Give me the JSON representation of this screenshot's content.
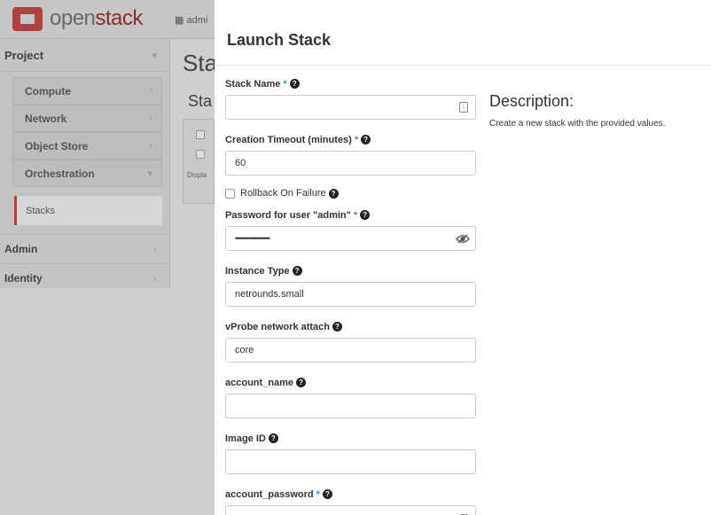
{
  "header": {
    "logo_left": "open",
    "logo_right": "stack",
    "project_switch": "admi"
  },
  "sidebar": {
    "project": "Project",
    "compute": "Compute",
    "network": "Network",
    "object_store": "Object Store",
    "orchestration": "Orchestration",
    "stacks": "Stacks",
    "admin": "Admin",
    "identity": "Identity"
  },
  "background": {
    "page_title": "Sta",
    "sub_title": "Sta",
    "table_hint": "Displa"
  },
  "modal": {
    "title": "Launch Stack",
    "description_title": "Description:",
    "description_text": "Create a new stack with the provided values.",
    "fields": {
      "stack_name": {
        "label": "Stack Name",
        "value": ""
      },
      "timeout": {
        "label": "Creation Timeout (minutes)",
        "value": "60"
      },
      "rollback": {
        "label": "Rollback On Failure"
      },
      "password": {
        "label": "Password for user \"admin\"",
        "value": "••••••••••••••••••"
      },
      "instance_type": {
        "label": "Instance Type",
        "value": "netrounds.small"
      },
      "vprobe": {
        "label": "vProbe network attach",
        "value": "core"
      },
      "account_name": {
        "label": "account_name",
        "value": ""
      },
      "image_id": {
        "label": "Image ID",
        "value": ""
      },
      "account_password": {
        "label": "account_password",
        "value": ""
      }
    },
    "required_mark": "*",
    "help_glyph": "?"
  }
}
